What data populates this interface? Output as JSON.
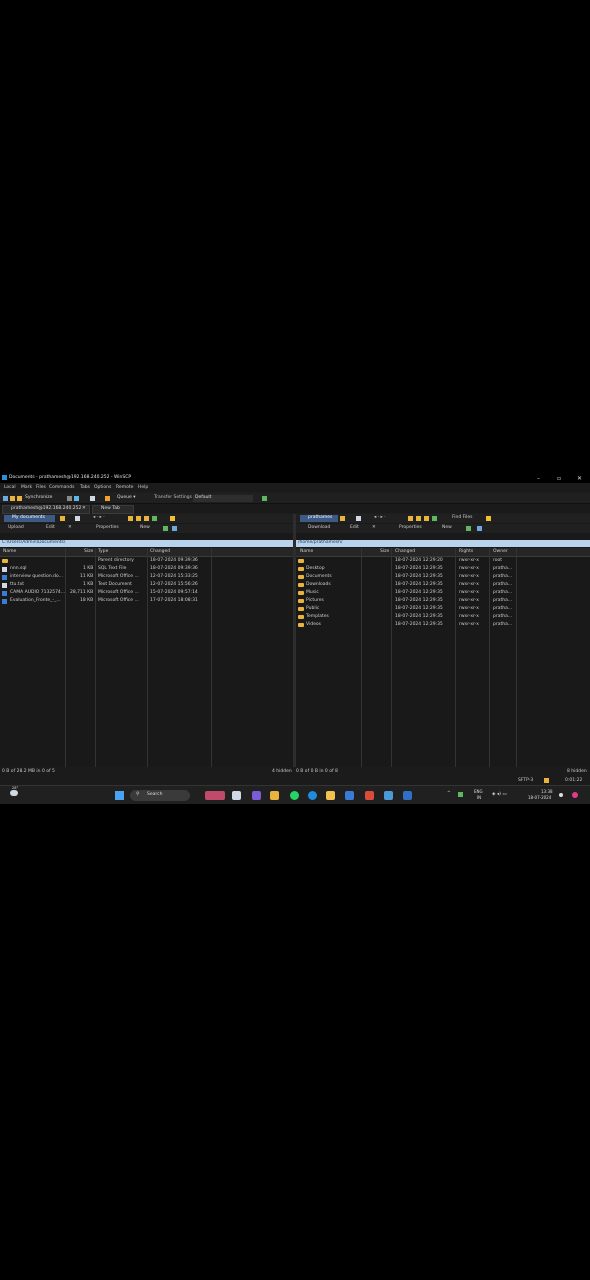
{
  "window": {
    "title": "Documents - prathamesh@192.168.240.252 - WinSCP",
    "minimize": "–",
    "maximize": "▫",
    "close": "✕"
  },
  "menu": [
    "Local",
    "Mark",
    "Files",
    "Commands",
    "Tabs",
    "Options",
    "Remote",
    "Help"
  ],
  "toolbar": {
    "synchronize": "Synchronize",
    "queue": "Queue ▾",
    "transfer_settings_label": "Transfer Settings",
    "transfer_settings_value": "Default"
  },
  "tabs": {
    "session": "prathamesh@192.168.240.252",
    "new_tab": "New Tab"
  },
  "left": {
    "location": "My documents",
    "upload": "Upload",
    "edit": "Edit",
    "properties": "Properties",
    "new": "New",
    "path": "C:\\Users\\Admin\\Documents\\",
    "columns": [
      "Name",
      "Size",
      "Type",
      "Changed"
    ],
    "rows": [
      {
        "name": "..",
        "size": "",
        "type": "Parent directory",
        "changed": "18-07-2024 09:39:36",
        "icon": "folder-up"
      },
      {
        "name": "nnn.sql",
        "size": "1 KB",
        "type": "SQL Text File",
        "changed": "18-07-2024 09:39:36",
        "icon": "doc"
      },
      {
        "name": "interview question.do...",
        "size": "11 KB",
        "type": "Microsoft Office ...",
        "changed": "12-07-2024 15:33:25",
        "icon": "docb"
      },
      {
        "name": "ttu.txt",
        "size": "1 KB",
        "type": "Text Document",
        "changed": "12-07-2024 15:56:26",
        "icon": "doc"
      },
      {
        "name": "CAMA AUDIO 7132574...",
        "size": "28,711 KB",
        "type": "Microsoft Office ...",
        "changed": "15-07-2024 09:57:14",
        "icon": "docb"
      },
      {
        "name": "Evaluation_Fronte_-_...",
        "size": "18 KB",
        "type": "Microsoft Office ...",
        "changed": "17-07-2024 18:08:31",
        "icon": "docb"
      }
    ],
    "status": "0 B of 28.2 MB in 0 of 5"
  },
  "right": {
    "location": "prathames",
    "download": "Download",
    "edit": "Edit",
    "properties": "Properties",
    "new": "New",
    "find_files": "Find Files",
    "path": "/home/prathamesh/",
    "columns": [
      "Name",
      "Size",
      "Changed",
      "Rights",
      "Owner"
    ],
    "rows": [
      {
        "name": "..",
        "changed": "18-07-2024 12:29:20",
        "rights": "rwxr-xr-x",
        "owner": "root"
      },
      {
        "name": "Desktop",
        "changed": "18-07-2024 12:29:35",
        "rights": "rwxr-xr-x",
        "owner": "pratha..."
      },
      {
        "name": "Documents",
        "changed": "18-07-2024 12:29:35",
        "rights": "rwxr-xr-x",
        "owner": "pratha..."
      },
      {
        "name": "Downloads",
        "changed": "18-07-2024 12:29:35",
        "rights": "rwxr-xr-x",
        "owner": "pratha..."
      },
      {
        "name": "Music",
        "changed": "18-07-2024 12:29:35",
        "rights": "rwxr-xr-x",
        "owner": "pratha..."
      },
      {
        "name": "Pictures",
        "changed": "18-07-2024 12:29:35",
        "rights": "rwxr-xr-x",
        "owner": "pratha..."
      },
      {
        "name": "Public",
        "changed": "18-07-2024 12:29:35",
        "rights": "rwxr-xr-x",
        "owner": "pratha..."
      },
      {
        "name": "Templates",
        "changed": "18-07-2024 12:29:35",
        "rights": "rwxr-xr-x",
        "owner": "pratha..."
      },
      {
        "name": "Videos",
        "changed": "18-07-2024 12:29:35",
        "rights": "rwxr-xr-x",
        "owner": "pratha..."
      }
    ],
    "hidden_left": "4 hidden",
    "status": "0 B of 0 B in 0 of 8",
    "hidden_right": "8 hidden",
    "protocol": "SFTP-3",
    "timer": "0:01:22"
  },
  "taskbar": {
    "weather_temp": "28°",
    "search": "Search",
    "lang": "ENG",
    "region": "IN",
    "time": "13:38",
    "date": "18-07-2024"
  }
}
